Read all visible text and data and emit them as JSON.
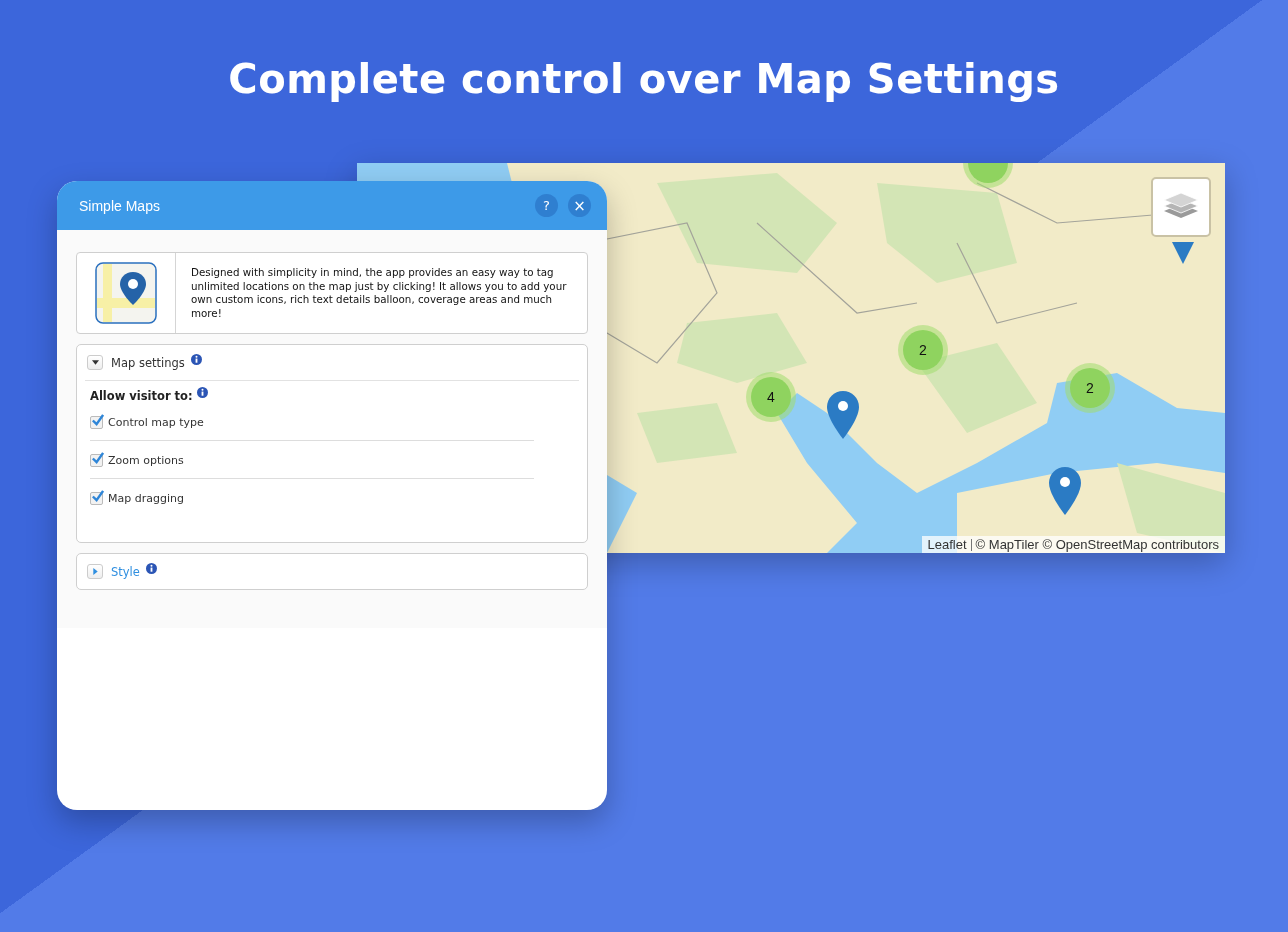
{
  "headline": "Complete control over Map Settings",
  "map": {
    "clusters": [
      {
        "count": "4"
      },
      {
        "count": "2"
      },
      {
        "count": "2"
      }
    ],
    "attribution": {
      "link": "Leaflet",
      "text": "© MapTiler © OpenStreetMap contributors"
    }
  },
  "panel": {
    "title": "Simple Maps",
    "help_button": "?",
    "close_button": "×",
    "description": "Designed with simplicity in mind, the app provides an easy way to tag unlimited locations on the map just by clicking! It allows you to add your own custom icons, rich text details balloon, coverage areas and much more!",
    "sections": [
      {
        "title": "Map settings",
        "expanded": true,
        "allow_label": "Allow visitor to:",
        "options": [
          {
            "label": "Control map type",
            "checked": true
          },
          {
            "label": "Zoom options",
            "checked": true
          },
          {
            "label": "Map dragging",
            "checked": true
          }
        ]
      },
      {
        "title": "Style",
        "expanded": false
      }
    ]
  }
}
